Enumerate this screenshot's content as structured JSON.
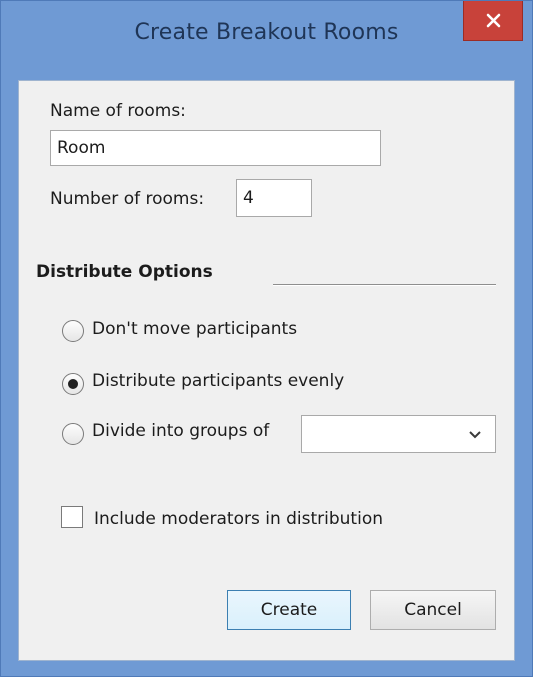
{
  "window": {
    "title": "Create Breakout Rooms"
  },
  "form": {
    "name_label": "Name of rooms:",
    "name_value": "Room",
    "number_label": "Number of rooms:",
    "number_value": "4",
    "distribute_heading": "Distribute Options",
    "options": [
      {
        "label": "Don't move participants",
        "selected": false
      },
      {
        "label": "Distribute participants evenly",
        "selected": true
      },
      {
        "label": "Divide into groups of",
        "selected": false
      }
    ],
    "groups_select_value": "",
    "include_moderators_label": "Include moderators in distribution",
    "include_moderators_checked": false
  },
  "buttons": {
    "create_label": "Create",
    "cancel_label": "Cancel"
  },
  "icons": {
    "close": "close-icon",
    "dropdown": "chevron-down-icon"
  },
  "colors": {
    "window_frame": "#6f9ad4",
    "close_button": "#c8423a",
    "dialog_background": "#f0f0f0"
  }
}
